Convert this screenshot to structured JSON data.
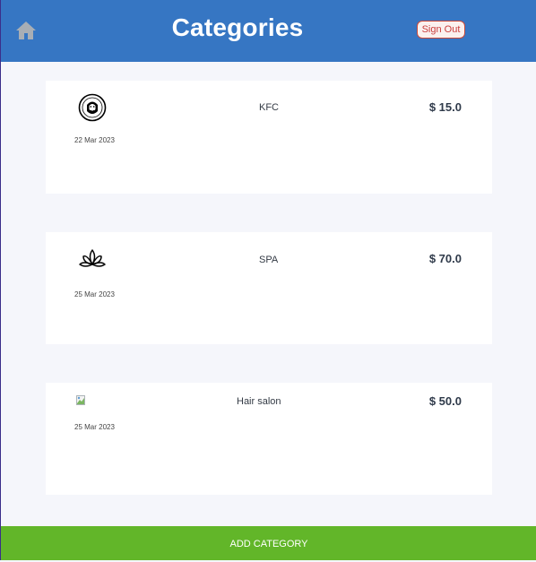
{
  "header": {
    "title": "Categories",
    "sign_out_label": "Sign Out",
    "home_icon": "home-icon"
  },
  "categories": [
    {
      "name": "KFC",
      "price": "$ 15.0",
      "date": "22 Mar 2023",
      "icon": "kfc-logo-icon"
    },
    {
      "name": "SPA",
      "price": "$ 70.0",
      "date": "25 Mar 2023",
      "icon": "lotus-icon"
    },
    {
      "name": "Hair salon",
      "price": "$ 50.0",
      "date": "25 Mar 2023",
      "icon": "broken-image-icon"
    }
  ],
  "footer": {
    "add_label": "ADD CATEGORY"
  },
  "colors": {
    "header_bg": "#3676c3",
    "footer_bg": "#62b629",
    "signout_border": "#c94a3a",
    "page_bg": "#f5f6fb"
  }
}
